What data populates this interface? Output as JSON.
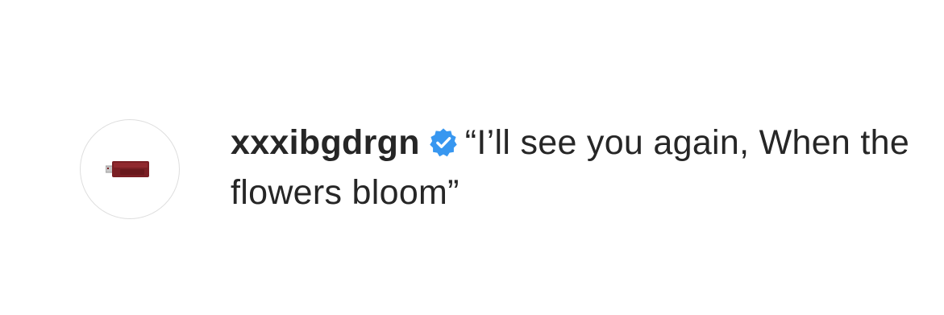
{
  "comment": {
    "username": "xxxibgdrgn",
    "text": "“I’ll see you again, When the flowers bloom”"
  },
  "avatar": {
    "icon": "usb-stick-icon",
    "accent": "#7a1f24"
  },
  "verified_badge": {
    "icon": "verified-badge-icon",
    "color": "#3897f0"
  }
}
